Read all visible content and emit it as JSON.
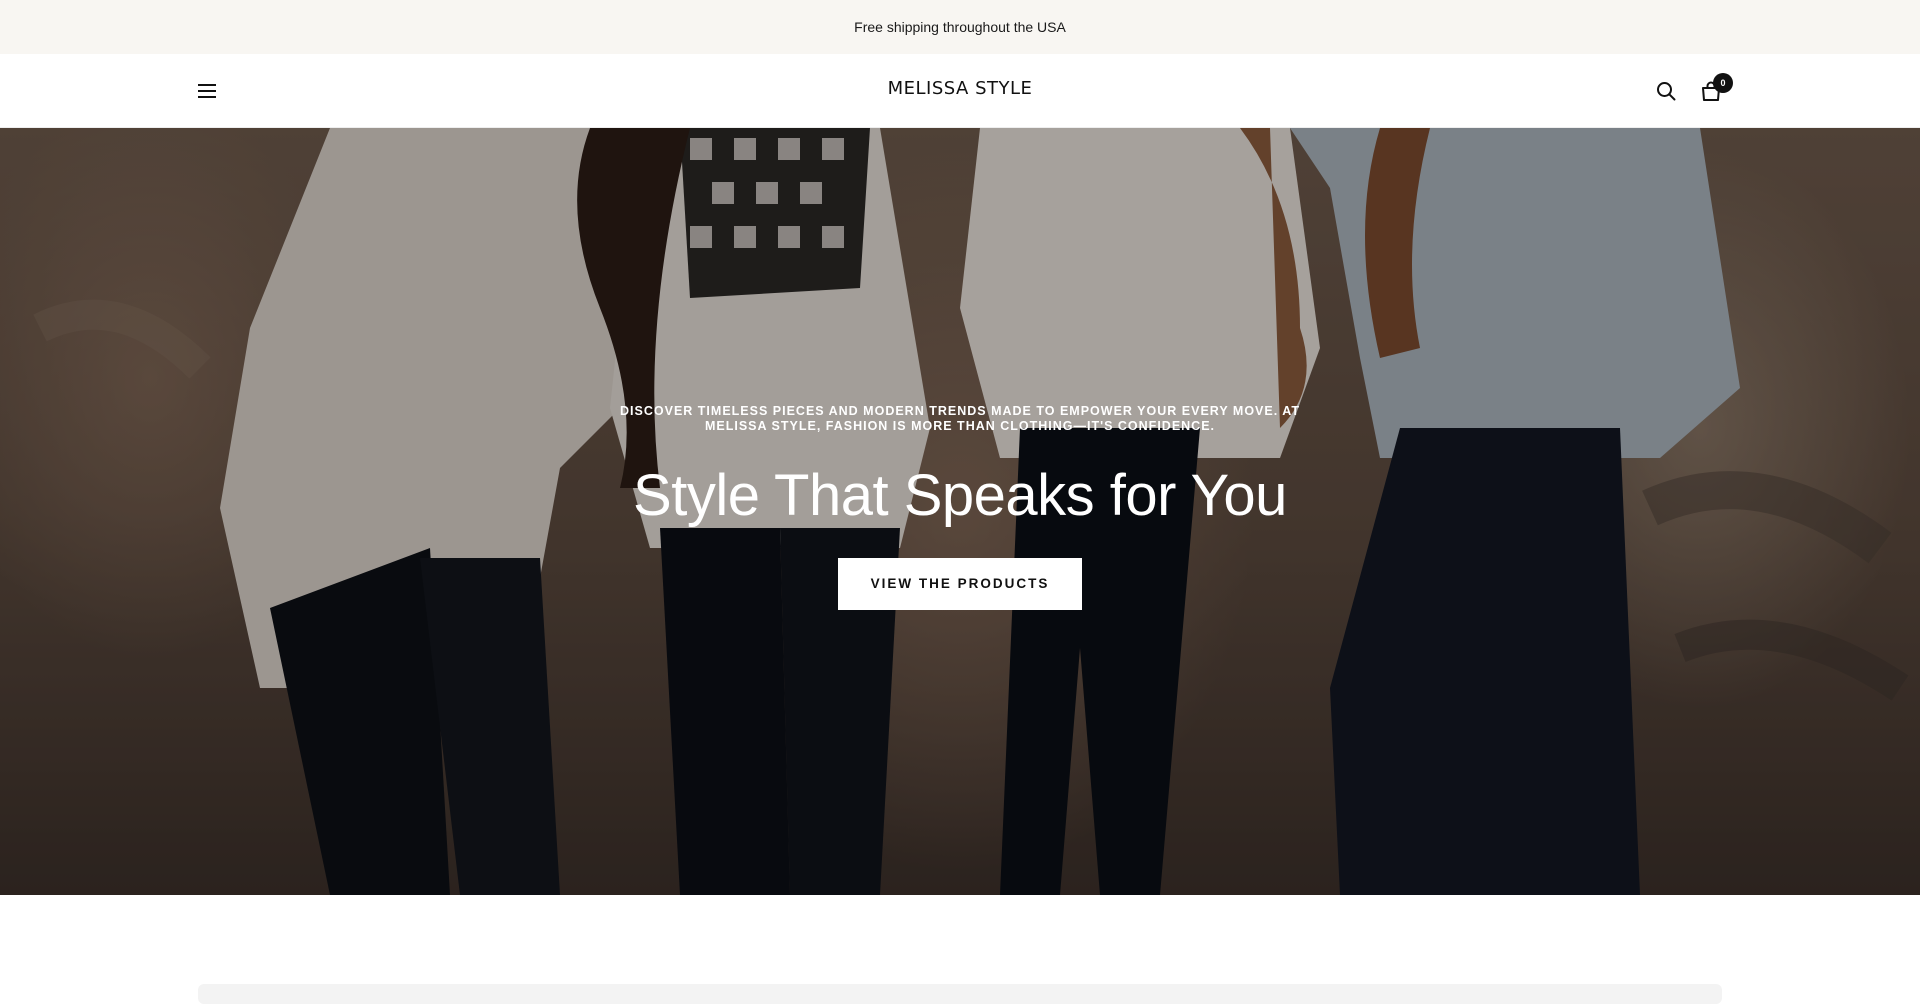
{
  "announcement": {
    "text": "Free shipping throughout the USA"
  },
  "header": {
    "menu_icon": "hamburger-menu-icon",
    "logo": "MELISSA STYLE",
    "search_icon": "search-icon",
    "cart_icon": "shopping-bag-icon",
    "cart_count": "0"
  },
  "hero": {
    "subtitle": "Discover timeless pieces and modern trends made to empower your every move. At Melissa Style, fashion is more than clothing—it's confidence.",
    "title": "Style That Speaks for You",
    "cta_label": "VIEW THE PRODUCTS"
  },
  "colors": {
    "announcement_bg": "#f8f6f2",
    "header_bg": "#ffffff",
    "text": "#111111",
    "cta_bg": "#ffffff",
    "badge_bg": "#111111"
  }
}
